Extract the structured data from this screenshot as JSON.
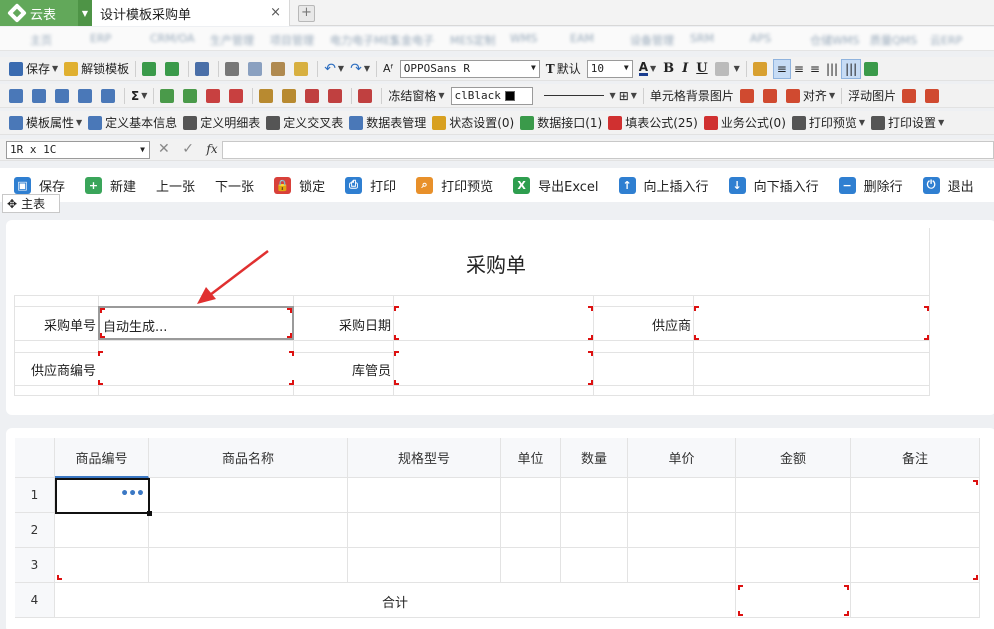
{
  "app": {
    "name": "云表",
    "tab_title": "设计模板采购单",
    "close": "×",
    "new_tab": "+"
  },
  "menu_blurred": [
    "主页",
    "ERP",
    "CRM/OA",
    "生产管理",
    "项目管理",
    "电力电子MES",
    "五金电子",
    "MES定制",
    "WMS",
    "EAM",
    "设备管理",
    "SRM",
    "APS",
    "仓储WMS",
    "质量QMS",
    "云ERP"
  ],
  "toolbar1": {
    "save": "保存",
    "unlock_template": "解锁模板",
    "font_name": "OPPOSans R",
    "font_default": "默认",
    "font_size": "10",
    "bold": "B",
    "italic": "I",
    "underline": "U"
  },
  "toolbar2": {
    "sum": "Σ",
    "freeze": "冻结窗格",
    "color_name": "clBlack",
    "cell_bg_image": "单元格背景图片",
    "align": "对齐",
    "float_image": "浮动图片"
  },
  "toolbar3": {
    "items": [
      "模板属性",
      "定义基本信息",
      "定义明细表",
      "定义交叉表",
      "数据表管理",
      "状态设置(0)",
      "数据接口(1)",
      "填表公式(25)",
      "业务公式(0)",
      "打印预览",
      "打印设置"
    ]
  },
  "formula": {
    "cell_ref": "1R x 1C",
    "cancel": "✕",
    "confirm": "✓",
    "fx": "fx"
  },
  "actions": [
    {
      "label": "保存",
      "color": "#2f7fd1",
      "glyph": "▣"
    },
    {
      "label": "新建",
      "color": "#3aa55a",
      "glyph": "+"
    },
    {
      "label": "上一张",
      "color": "",
      "glyph": ""
    },
    {
      "label": "下一张",
      "color": "",
      "glyph": ""
    },
    {
      "label": "锁定",
      "color": "#d8403a",
      "glyph": "🔒"
    },
    {
      "label": "打印",
      "color": "#2f7fd1",
      "glyph": "⎙"
    },
    {
      "label": "打印预览",
      "color": "#e8902a",
      "glyph": "⌕"
    },
    {
      "label": "导出Excel",
      "color": "#2e9e4f",
      "glyph": "X"
    },
    {
      "label": "向上插入行",
      "color": "#2f7fd1",
      "glyph": "↑"
    },
    {
      "label": "向下插入行",
      "color": "#2f7fd1",
      "glyph": "↓"
    },
    {
      "label": "删除行",
      "color": "#2f7fd1",
      "glyph": "−"
    },
    {
      "label": "退出",
      "color": "#2f7fd1",
      "glyph": "⏻"
    }
  ],
  "main_tab": "主表",
  "form": {
    "title": "采购单",
    "order_no_label": "采购单号",
    "order_no_value": "自动生成...",
    "order_date_label": "采购日期",
    "supplier_label": "供应商",
    "supplier_code_label": "供应商编号",
    "keeper_label": "库管员"
  },
  "detail": {
    "columns": [
      "商品编号",
      "商品名称",
      "规格型号",
      "单位",
      "数量",
      "单价",
      "金额",
      "备注"
    ],
    "row_numbers": [
      "1",
      "2",
      "3",
      "4"
    ],
    "total_label": "合计",
    "more": "•••"
  },
  "colors": {
    "brand_green": "#62a85a",
    "marker_red": "#d11111",
    "accent_blue": "#3b78c4"
  }
}
